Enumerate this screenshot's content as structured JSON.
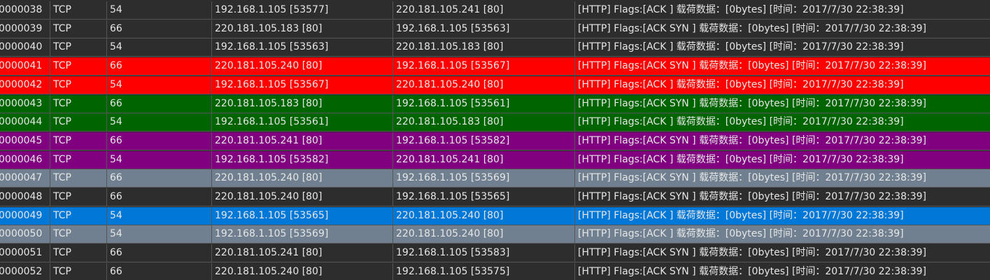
{
  "colors": {
    "default": "#2d2d2d",
    "red": "#ff0000",
    "green": "#006400",
    "purple": "#800080",
    "slate": "#708090",
    "blue": "#0078d7"
  },
  "rows": [
    {
      "no": "0000038",
      "protocol": "TCP",
      "length": "54",
      "source": "192.168.1.105 [53577]",
      "destination": "220.181.105.241 [80]",
      "info": "[HTTP] Flags:[ACK ] 载荷数据：[0bytes] [时间：2017/7/30 22:38:39]",
      "bg": "#2d2d2d"
    },
    {
      "no": "0000039",
      "protocol": "TCP",
      "length": "66",
      "source": "220.181.105.183 [80]",
      "destination": "192.168.1.105 [53563]",
      "info": "[HTTP] Flags:[ACK SYN ] 载荷数据：[0bytes] [时间：2017/7/30 22:38:39]",
      "bg": "#2d2d2d"
    },
    {
      "no": "0000040",
      "protocol": "TCP",
      "length": "54",
      "source": "192.168.1.105 [53563]",
      "destination": "220.181.105.183 [80]",
      "info": "[HTTP] Flags:[ACK ] 载荷数据：[0bytes] [时间：2017/7/30 22:38:39]",
      "bg": "#2d2d2d"
    },
    {
      "no": "0000041",
      "protocol": "TCP",
      "length": "66",
      "source": "220.181.105.240 [80]",
      "destination": "192.168.1.105 [53567]",
      "info": "[HTTP] Flags:[ACK SYN ] 载荷数据：[0bytes] [时间：2017/7/30 22:38:39]",
      "bg": "#ff0000"
    },
    {
      "no": "0000042",
      "protocol": "TCP",
      "length": "54",
      "source": "192.168.1.105 [53567]",
      "destination": "220.181.105.240 [80]",
      "info": "[HTTP] Flags:[ACK ] 载荷数据：[0bytes] [时间：2017/7/30 22:38:39]",
      "bg": "#ff0000"
    },
    {
      "no": "0000043",
      "protocol": "TCP",
      "length": "66",
      "source": "220.181.105.183 [80]",
      "destination": "192.168.1.105 [53561]",
      "info": "[HTTP] Flags:[ACK SYN ] 载荷数据：[0bytes] [时间：2017/7/30 22:38:39]",
      "bg": "#006400"
    },
    {
      "no": "0000044",
      "protocol": "TCP",
      "length": "54",
      "source": "192.168.1.105 [53561]",
      "destination": "220.181.105.183 [80]",
      "info": "[HTTP] Flags:[ACK ] 载荷数据：[0bytes] [时间：2017/7/30 22:38:39]",
      "bg": "#006400"
    },
    {
      "no": "0000045",
      "protocol": "TCP",
      "length": "66",
      "source": "220.181.105.241 [80]",
      "destination": "192.168.1.105 [53582]",
      "info": "[HTTP] Flags:[ACK SYN ] 载荷数据：[0bytes] [时间：2017/7/30 22:38:39]",
      "bg": "#800080"
    },
    {
      "no": "0000046",
      "protocol": "TCP",
      "length": "54",
      "source": "192.168.1.105 [53582]",
      "destination": "220.181.105.241 [80]",
      "info": "[HTTP] Flags:[ACK ] 载荷数据：[0bytes] [时间：2017/7/30 22:38:39]",
      "bg": "#800080"
    },
    {
      "no": "0000047",
      "protocol": "TCP",
      "length": "66",
      "source": "220.181.105.240 [80]",
      "destination": "192.168.1.105 [53569]",
      "info": "[HTTP] Flags:[ACK SYN ] 载荷数据：[0bytes] [时间：2017/7/30 22:38:39]",
      "bg": "#708090"
    },
    {
      "no": "0000048",
      "protocol": "TCP",
      "length": "66",
      "source": "220.181.105.240 [80]",
      "destination": "192.168.1.105 [53565]",
      "info": "[HTTP] Flags:[ACK SYN ] 载荷数据：[0bytes] [时间：2017/7/30 22:38:39]",
      "bg": "#2d2d2d"
    },
    {
      "no": "0000049",
      "protocol": "TCP",
      "length": "54",
      "source": "192.168.1.105 [53565]",
      "destination": "220.181.105.240 [80]",
      "info": "[HTTP] Flags:[ACK ] 载荷数据：[0bytes] [时间：2017/7/30 22:38:39]",
      "bg": "#0078d7"
    },
    {
      "no": "0000050",
      "protocol": "TCP",
      "length": "54",
      "source": "192.168.1.105 [53569]",
      "destination": "220.181.105.240 [80]",
      "info": "[HTTP] Flags:[ACK ] 载荷数据：[0bytes] [时间：2017/7/30 22:38:39]",
      "bg": "#708090"
    },
    {
      "no": "0000051",
      "protocol": "TCP",
      "length": "66",
      "source": "220.181.105.241 [80]",
      "destination": "192.168.1.105 [53583]",
      "info": "[HTTP] Flags:[ACK SYN ] 载荷数据：[0bytes] [时间：2017/7/30 22:38:39]",
      "bg": "#2d2d2d"
    },
    {
      "no": "0000052",
      "protocol": "TCP",
      "length": "66",
      "source": "220.181.105.240 [80]",
      "destination": "192.168.1.105 [53575]",
      "info": "[HTTP] Flags:[ACK SYN ] 载荷数据：[0bytes] [时间：2017/7/30 22:38:39]",
      "bg": "#2d2d2d"
    }
  ]
}
